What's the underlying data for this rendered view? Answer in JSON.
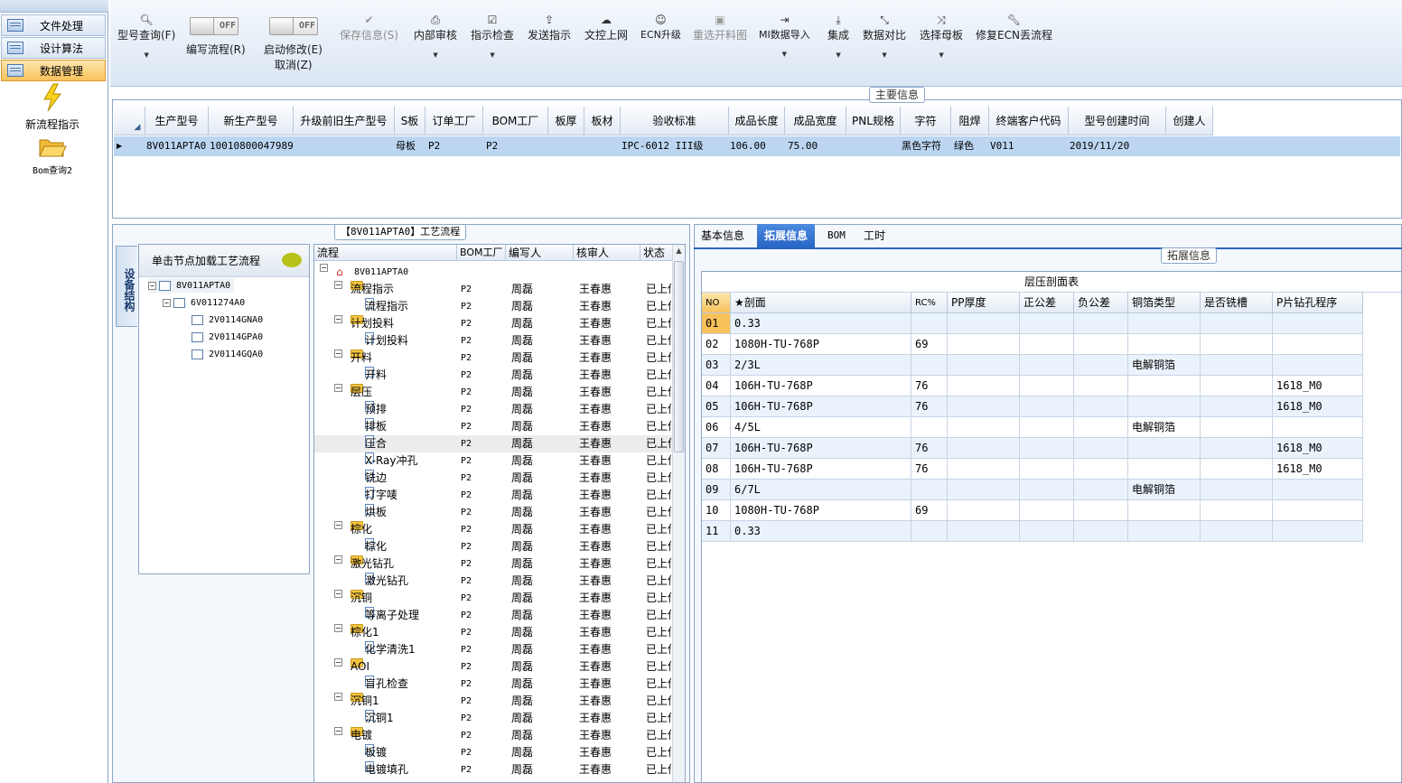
{
  "left_nav": {
    "items": [
      {
        "label": "文件处理",
        "selected": false
      },
      {
        "label": "设计算法",
        "selected": false
      },
      {
        "label": "数据管理",
        "selected": true
      }
    ],
    "shortcuts": [
      {
        "label": "新流程指示",
        "icon": "lightning-icon"
      },
      {
        "label": "Bom查询2",
        "icon": "folder-open-icon"
      }
    ]
  },
  "toolbar": {
    "model_query": "型号查询(F)",
    "write_flow": "编写流程(R)",
    "start_modify": "启动修改(E)",
    "cancel": "取消(Z)",
    "toggle_off": "OFF",
    "save_info": "保存信息(S)",
    "internal_review": "内部审核",
    "instruction_check": "指示检查",
    "send_instruction": "发送指示",
    "doc_online": "文控上网",
    "ecn_upgrade": "ECN升级",
    "reselect_cut_chart": "重选开料图",
    "mi_import": "MI数据导入",
    "integrate": "集成",
    "data_compare": "数据对比",
    "select_mother_board": "选择母板",
    "repair_ecn_flow": "修复ECN丢流程"
  },
  "main_info": {
    "title": "主要信息",
    "columns": [
      "生产型号",
      "新生产型号",
      "升级前旧生产型号",
      "S板",
      "订单工厂",
      "BOM工厂",
      "板厚",
      "板材",
      "验收标准",
      "成品长度",
      "成品宽度",
      "PNL规格",
      "字符",
      "阻焊",
      "终端客户代码",
      "型号创建时间",
      "创建人"
    ],
    "row": {
      "production_model": "8V011APTA0",
      "new_model": "10010800047989",
      "old_model": "",
      "s_board": "母板",
      "order_factory": "P2",
      "bom_factory": "P2",
      "thickness": "",
      "material": "",
      "standard": "IPC-6012 III级",
      "length": "106.00",
      "width": "75.00",
      "pnl_spec": "",
      "character": "黑色字符",
      "solder_mask": "绿色",
      "customer_code": "V011",
      "created_time": "2019/11/20",
      "creator": ""
    }
  },
  "process_panel": {
    "title": "【8V011APTA0】工艺流程",
    "vertical_tab": "设备结构",
    "load_hint": "单击节点加载工艺流程",
    "tree": [
      {
        "label": "8V011APTA0",
        "level": 0
      },
      {
        "label": "6V011274A0",
        "level": 1
      },
      {
        "label": "2V0114GNA0",
        "level": 2
      },
      {
        "label": "2V0114GPA0",
        "level": 2
      },
      {
        "label": "2V0114GQA0",
        "level": 2
      }
    ],
    "grid_headers": [
      "流程",
      "BOM工厂",
      "编写人",
      "核审人",
      "状态"
    ],
    "root": "8V011APTA0",
    "rows": [
      {
        "name": "流程指示",
        "folder": true,
        "bom": "P2",
        "writer": "周磊",
        "reviewer": "王春惠",
        "status": "已上传"
      },
      {
        "name": "流程指示",
        "folder": false,
        "bom": "P2",
        "writer": "周磊",
        "reviewer": "王春惠",
        "status": "已上传"
      },
      {
        "name": "计划投料",
        "folder": true,
        "bom": "P2",
        "writer": "周磊",
        "reviewer": "王春惠",
        "status": "已上传"
      },
      {
        "name": "计划投料",
        "folder": false,
        "bom": "P2",
        "writer": "周磊",
        "reviewer": "王春惠",
        "status": "已上传"
      },
      {
        "name": "开料",
        "folder": true,
        "bom": "P2",
        "writer": "周磊",
        "reviewer": "王春惠",
        "status": "已上传"
      },
      {
        "name": "开料",
        "folder": false,
        "bom": "P2",
        "writer": "周磊",
        "reviewer": "王春惠",
        "status": "已上传"
      },
      {
        "name": "层压",
        "folder": true,
        "bom": "P2",
        "writer": "周磊",
        "reviewer": "王春惠",
        "status": "已上传"
      },
      {
        "name": "预排",
        "folder": false,
        "bom": "P2",
        "writer": "周磊",
        "reviewer": "王春惠",
        "status": "已上传"
      },
      {
        "name": "排板",
        "folder": false,
        "bom": "P2",
        "writer": "周磊",
        "reviewer": "王春惠",
        "status": "已上传"
      },
      {
        "name": "压合",
        "folder": false,
        "bom": "P2",
        "writer": "周磊",
        "reviewer": "王春惠",
        "status": "已上传",
        "selected": true
      },
      {
        "name": "X-Ray冲孔",
        "folder": false,
        "bom": "P2",
        "writer": "周磊",
        "reviewer": "王春惠",
        "status": "已上传"
      },
      {
        "name": "铣边",
        "folder": false,
        "bom": "P2",
        "writer": "周磊",
        "reviewer": "王春惠",
        "status": "已上传"
      },
      {
        "name": "打字唛",
        "folder": false,
        "bom": "P2",
        "writer": "周磊",
        "reviewer": "王春惠",
        "status": "已上传"
      },
      {
        "name": "烘板",
        "folder": false,
        "bom": "P2",
        "writer": "周磊",
        "reviewer": "王春惠",
        "status": "已上传"
      },
      {
        "name": "棕化",
        "folder": true,
        "bom": "P2",
        "writer": "周磊",
        "reviewer": "王春惠",
        "status": "已上传"
      },
      {
        "name": "棕化",
        "folder": false,
        "bom": "P2",
        "writer": "周磊",
        "reviewer": "王春惠",
        "status": "已上传"
      },
      {
        "name": "激光钻孔",
        "folder": true,
        "bom": "P2",
        "writer": "周磊",
        "reviewer": "王春惠",
        "status": "已上传"
      },
      {
        "name": "激光钻孔",
        "folder": false,
        "bom": "P2",
        "writer": "周磊",
        "reviewer": "王春惠",
        "status": "已上传"
      },
      {
        "name": "沉铜",
        "folder": true,
        "bom": "P2",
        "writer": "周磊",
        "reviewer": "王春惠",
        "status": "已上传"
      },
      {
        "name": "等离子处理",
        "folder": false,
        "bom": "P2",
        "writer": "周磊",
        "reviewer": "王春惠",
        "status": "已上传"
      },
      {
        "name": "棕化1",
        "folder": true,
        "bom": "P2",
        "writer": "周磊",
        "reviewer": "王春惠",
        "status": "已上传"
      },
      {
        "name": "化学清洗1",
        "folder": false,
        "bom": "P2",
        "writer": "周磊",
        "reviewer": "王春惠",
        "status": "已上传"
      },
      {
        "name": "AOI",
        "folder": true,
        "bom": "P2",
        "writer": "周磊",
        "reviewer": "王春惠",
        "status": "已上传"
      },
      {
        "name": "盲孔检查",
        "folder": false,
        "bom": "P2",
        "writer": "周磊",
        "reviewer": "王春惠",
        "status": "已上传"
      },
      {
        "name": "沉铜1",
        "folder": true,
        "bom": "P2",
        "writer": "周磊",
        "reviewer": "王春惠",
        "status": "已上传"
      },
      {
        "name": "沉铜1",
        "folder": false,
        "bom": "P2",
        "writer": "周磊",
        "reviewer": "王春惠",
        "status": "已上传"
      },
      {
        "name": "电镀",
        "folder": true,
        "bom": "P2",
        "writer": "周磊",
        "reviewer": "王春惠",
        "status": "已上传"
      },
      {
        "name": "板镀",
        "folder": false,
        "bom": "P2",
        "writer": "周磊",
        "reviewer": "王春惠",
        "status": "已上传"
      },
      {
        "name": "电镀填孔",
        "folder": false,
        "bom": "P2",
        "writer": "周磊",
        "reviewer": "王春惠",
        "status": "已上传"
      }
    ]
  },
  "right_panel": {
    "tabs": [
      "基本信息",
      "拓展信息",
      "BOM",
      "工时"
    ],
    "active_tab": 1,
    "group_title": "拓展信息",
    "table_title": "层压剖面表",
    "columns": [
      "NO",
      "★剖面",
      "RC%",
      "PP厚度",
      "正公差",
      "负公差",
      "铜箔类型",
      "是否铣槽",
      "P片钻孔程序"
    ],
    "rows": [
      [
        "01",
        "0.33",
        "",
        "",
        "",
        "",
        "",
        "",
        ""
      ],
      [
        "02",
        "1080H-TU-768P",
        "69",
        "",
        "",
        "",
        "",
        "",
        ""
      ],
      [
        "03",
        "2/3L",
        "",
        "",
        "",
        "",
        "电解铜箔",
        "",
        ""
      ],
      [
        "04",
        "106H-TU-768P",
        "76",
        "",
        "",
        "",
        "",
        "",
        "1618_M0"
      ],
      [
        "05",
        "106H-TU-768P",
        "76",
        "",
        "",
        "",
        "",
        "",
        "1618_M0"
      ],
      [
        "06",
        "4/5L",
        "",
        "",
        "",
        "",
        "电解铜箔",
        "",
        ""
      ],
      [
        "07",
        "106H-TU-768P",
        "76",
        "",
        "",
        "",
        "",
        "",
        "1618_M0"
      ],
      [
        "08",
        "106H-TU-768P",
        "76",
        "",
        "",
        "",
        "",
        "",
        "1618_M0"
      ],
      [
        "09",
        "6/7L",
        "",
        "",
        "",
        "",
        "电解铜箔",
        "",
        ""
      ],
      [
        "10",
        "1080H-TU-768P",
        "69",
        "",
        "",
        "",
        "",
        "",
        ""
      ],
      [
        "11",
        "0.33",
        "",
        "",
        "",
        "",
        "",
        "",
        ""
      ]
    ]
  },
  "colors": {
    "accent_tab": "#2865c5",
    "selected_row": "#bcd6f2",
    "nav_selected": "#f8c25a"
  }
}
